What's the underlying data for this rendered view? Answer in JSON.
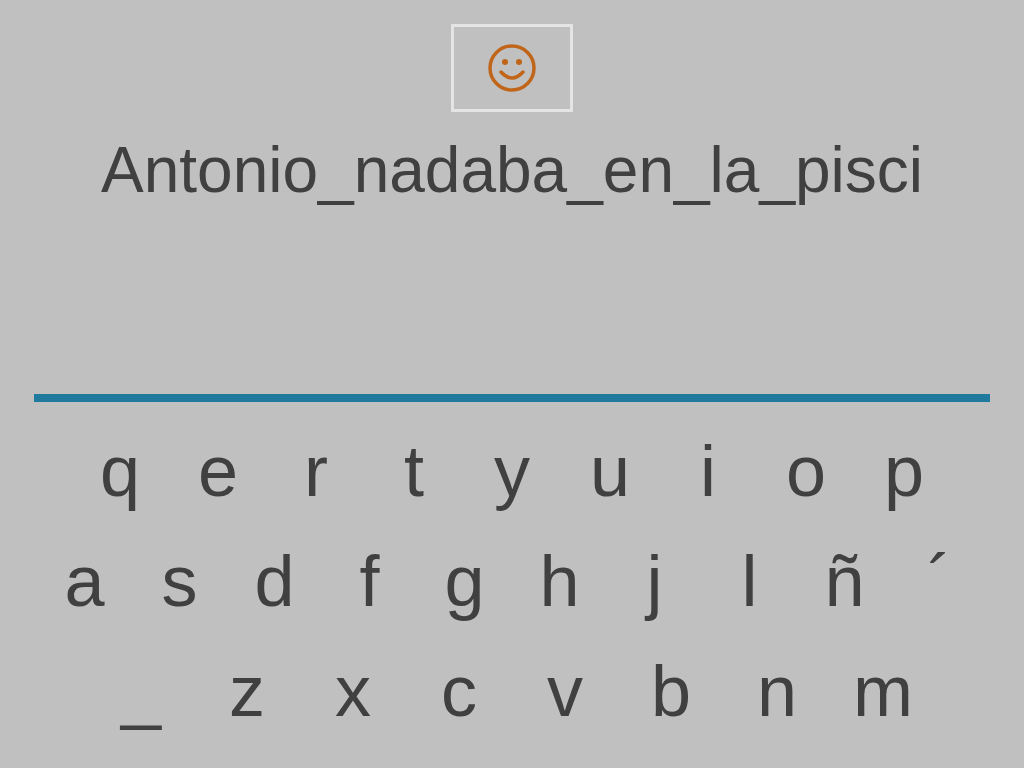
{
  "sentence": "Antonio_nadaba_en_la_pisci",
  "keyboard": [
    [
      "q",
      "e",
      "r",
      "t",
      "y",
      "u",
      "i",
      "o",
      "p"
    ],
    [
      "a",
      "s",
      "d",
      "f",
      "g",
      "h",
      "j",
      "l",
      "ñ",
      "´"
    ],
    [
      "_",
      "z",
      "x",
      "c",
      "v",
      "b",
      "n",
      "m"
    ]
  ]
}
